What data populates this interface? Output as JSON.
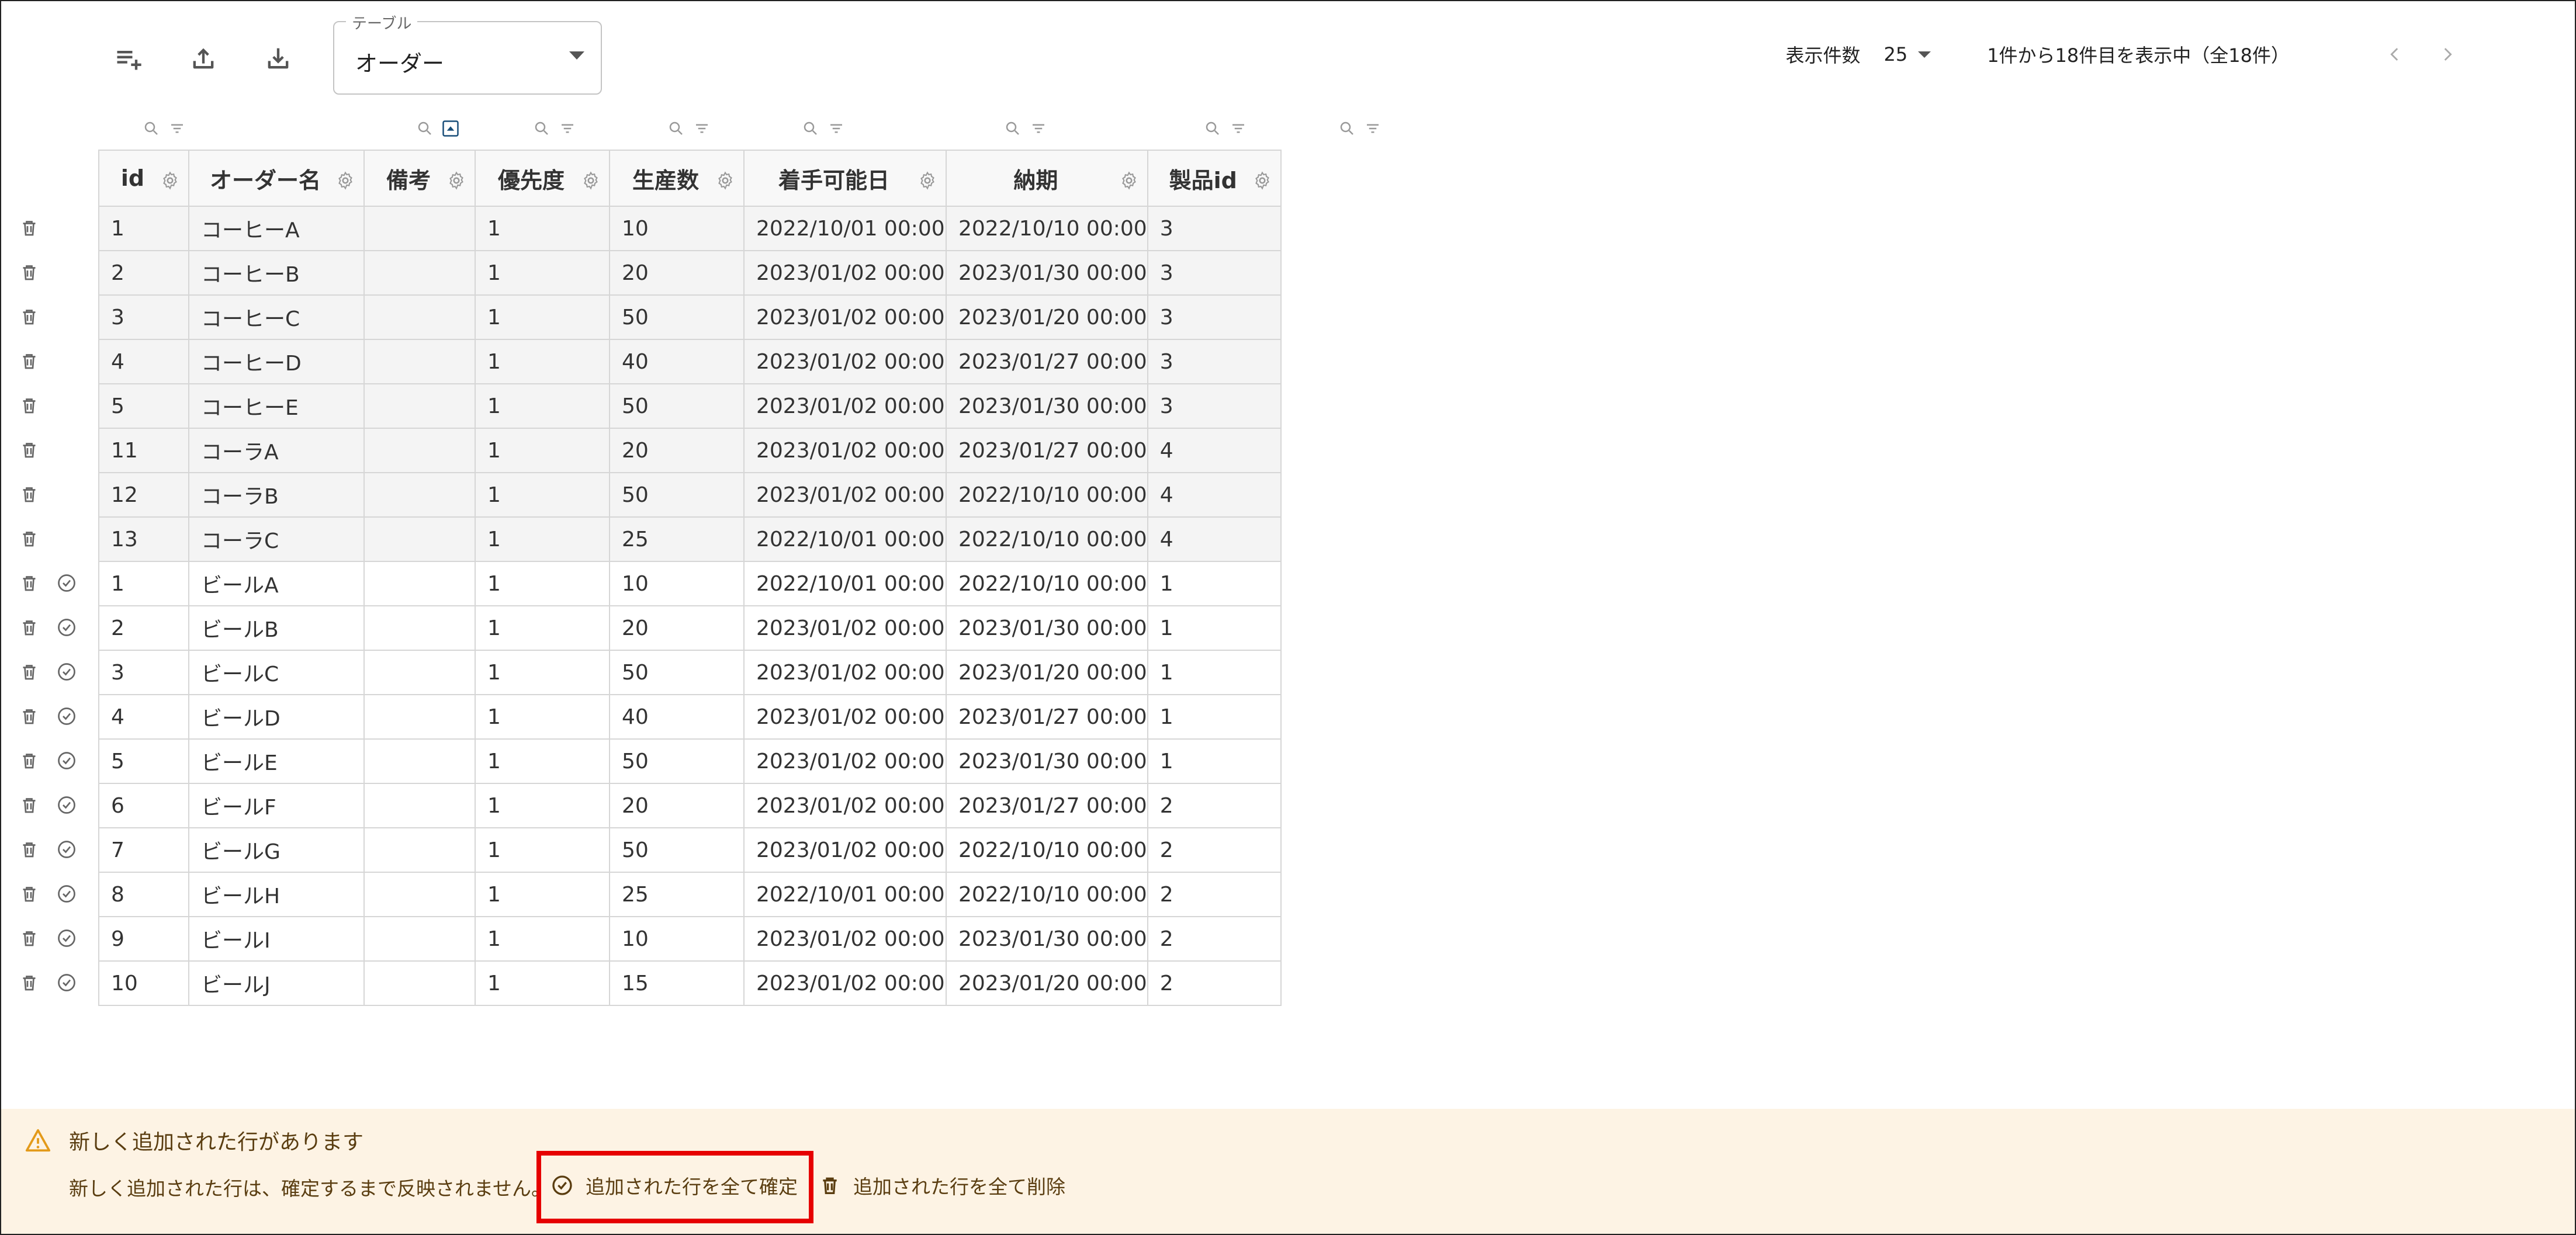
{
  "toolbar": {
    "add_rows_icon": "playlist-add-icon",
    "upload_icon": "upload-icon",
    "download_icon": "download-icon",
    "table_select_label": "テーブル",
    "table_select_value": "オーダー"
  },
  "pager": {
    "rows_per_page_label": "表示件数",
    "rows_per_page_value": "25",
    "range_text": "1件から18件目を表示中（全18件）"
  },
  "table": {
    "columns": [
      "id",
      "オーダー名",
      "備考",
      "優先度",
      "生産数",
      "着手可能日",
      "納期",
      "製品id"
    ],
    "rows": [
      {
        "id": "1",
        "name": "コーヒーA",
        "note": "",
        "priority": "1",
        "qty": "10",
        "start": "2022/10/01 00:00",
        "due": "2022/10/10 00:00",
        "product_id": "3",
        "confirmed": true
      },
      {
        "id": "2",
        "name": "コーヒーB",
        "note": "",
        "priority": "1",
        "qty": "20",
        "start": "2023/01/02 00:00",
        "due": "2023/01/30 00:00",
        "product_id": "3",
        "confirmed": true
      },
      {
        "id": "3",
        "name": "コーヒーC",
        "note": "",
        "priority": "1",
        "qty": "50",
        "start": "2023/01/02 00:00",
        "due": "2023/01/20 00:00",
        "product_id": "3",
        "confirmed": true
      },
      {
        "id": "4",
        "name": "コーヒーD",
        "note": "",
        "priority": "1",
        "qty": "40",
        "start": "2023/01/02 00:00",
        "due": "2023/01/27 00:00",
        "product_id": "3",
        "confirmed": true
      },
      {
        "id": "5",
        "name": "コーヒーE",
        "note": "",
        "priority": "1",
        "qty": "50",
        "start": "2023/01/02 00:00",
        "due": "2023/01/30 00:00",
        "product_id": "3",
        "confirmed": true
      },
      {
        "id": "11",
        "name": "コーラA",
        "note": "",
        "priority": "1",
        "qty": "20",
        "start": "2023/01/02 00:00",
        "due": "2023/01/27 00:00",
        "product_id": "4",
        "confirmed": true
      },
      {
        "id": "12",
        "name": "コーラB",
        "note": "",
        "priority": "1",
        "qty": "50",
        "start": "2023/01/02 00:00",
        "due": "2022/10/10 00:00",
        "product_id": "4",
        "confirmed": true
      },
      {
        "id": "13",
        "name": "コーラC",
        "note": "",
        "priority": "1",
        "qty": "25",
        "start": "2022/10/01 00:00",
        "due": "2022/10/10 00:00",
        "product_id": "4",
        "confirmed": true
      },
      {
        "id": "1",
        "name": "ビールA",
        "note": "",
        "priority": "1",
        "qty": "10",
        "start": "2022/10/01 00:00",
        "due": "2022/10/10 00:00",
        "product_id": "1",
        "confirmed": false
      },
      {
        "id": "2",
        "name": "ビールB",
        "note": "",
        "priority": "1",
        "qty": "20",
        "start": "2023/01/02 00:00",
        "due": "2023/01/30 00:00",
        "product_id": "1",
        "confirmed": false
      },
      {
        "id": "3",
        "name": "ビールC",
        "note": "",
        "priority": "1",
        "qty": "50",
        "start": "2023/01/02 00:00",
        "due": "2023/01/20 00:00",
        "product_id": "1",
        "confirmed": false
      },
      {
        "id": "4",
        "name": "ビールD",
        "note": "",
        "priority": "1",
        "qty": "40",
        "start": "2023/01/02 00:00",
        "due": "2023/01/27 00:00",
        "product_id": "1",
        "confirmed": false
      },
      {
        "id": "5",
        "name": "ビールE",
        "note": "",
        "priority": "1",
        "qty": "50",
        "start": "2023/01/02 00:00",
        "due": "2023/01/30 00:00",
        "product_id": "1",
        "confirmed": false
      },
      {
        "id": "6",
        "name": "ビールF",
        "note": "",
        "priority": "1",
        "qty": "20",
        "start": "2023/01/02 00:00",
        "due": "2023/01/27 00:00",
        "product_id": "2",
        "confirmed": false
      },
      {
        "id": "7",
        "name": "ビールG",
        "note": "",
        "priority": "1",
        "qty": "50",
        "start": "2023/01/02 00:00",
        "due": "2022/10/10 00:00",
        "product_id": "2",
        "confirmed": false
      },
      {
        "id": "8",
        "name": "ビールH",
        "note": "",
        "priority": "1",
        "qty": "25",
        "start": "2022/10/01 00:00",
        "due": "2022/10/10 00:00",
        "product_id": "2",
        "confirmed": false
      },
      {
        "id": "9",
        "name": "ビールI",
        "note": "",
        "priority": "1",
        "qty": "10",
        "start": "2023/01/02 00:00",
        "due": "2023/01/30 00:00",
        "product_id": "2",
        "confirmed": false
      },
      {
        "id": "10",
        "name": "ビールJ",
        "note": "",
        "priority": "1",
        "qty": "15",
        "start": "2023/01/02 00:00",
        "due": "2023/01/20 00:00",
        "product_id": "2",
        "confirmed": false
      }
    ]
  },
  "alert": {
    "title": "新しく追加された行があります",
    "message": "新しく追加された行は、確定するまで反映されません。",
    "confirm_all_label": "追加された行を全て確定",
    "delete_all_label": "追加された行を全て削除"
  },
  "colors": {
    "alert_background": "#fdf3e4",
    "alert_icon": "#e39a1a",
    "highlight_border": "#e60000",
    "confirmed_row_bg": "#f4f4f4"
  }
}
